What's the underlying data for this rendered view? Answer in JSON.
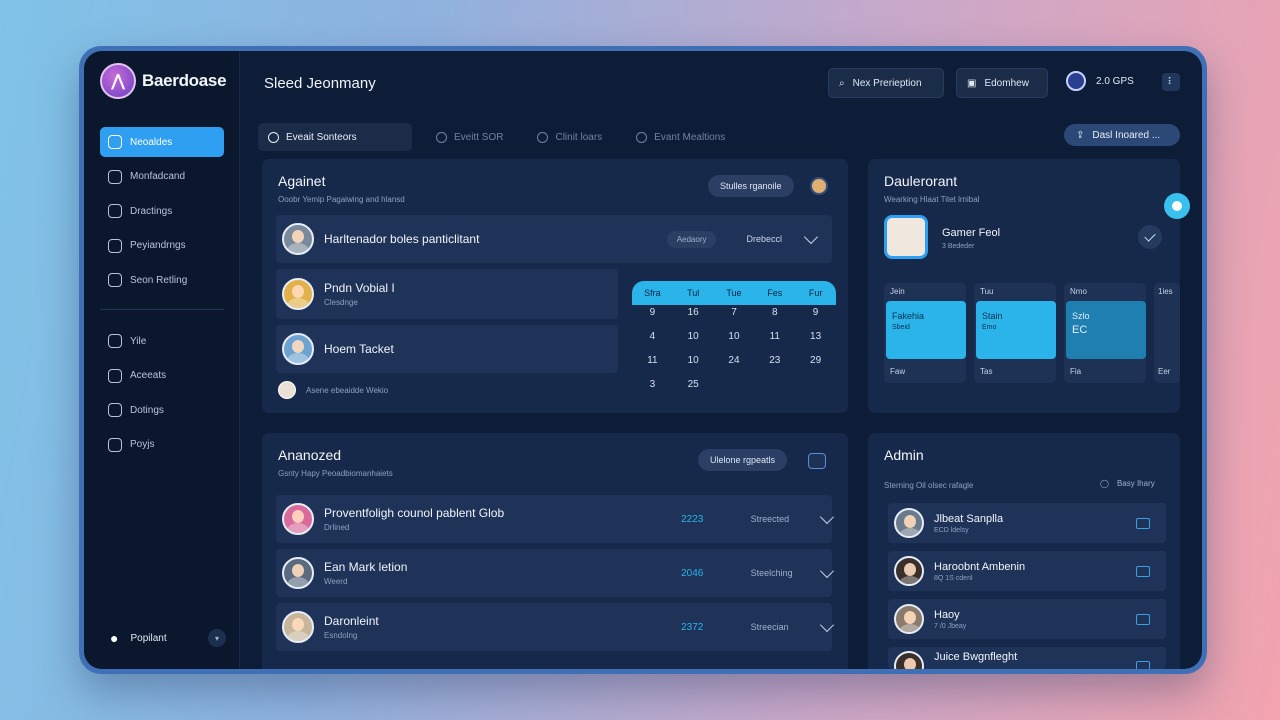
{
  "app": {
    "name": "Baerdoase",
    "page_title": "Sleed Jeonmany"
  },
  "header": {
    "search_label": "Nex Prerieption",
    "edit_label": "Edomhew",
    "status_label": "2.0 GPS",
    "menu_glyph": "⠇"
  },
  "sidebar": {
    "items": [
      {
        "label": "Neoaldes",
        "icon": "globe-icon"
      },
      {
        "label": "Monfadcand",
        "icon": "clock-icon"
      },
      {
        "label": "Dractings",
        "icon": "gear-icon"
      },
      {
        "label": "Peyiandrngs",
        "icon": "folder-icon"
      },
      {
        "label": "Seon Retling",
        "icon": "shield-icon"
      }
    ],
    "items2": [
      {
        "label": "Yile",
        "icon": "link-icon"
      },
      {
        "label": "Aceeats",
        "icon": "bell-icon"
      },
      {
        "label": "Dotings",
        "icon": "chat-icon"
      },
      {
        "label": "Poyjs",
        "icon": "doc-icon"
      }
    ],
    "footer_label": "Popilant"
  },
  "tabs": [
    {
      "label": "Eveait Sonteors"
    },
    {
      "label": "Eveitt SOR"
    },
    {
      "label": "Clinit loars"
    },
    {
      "label": "Evant Mealtions"
    }
  ],
  "tab_action": "Dasl Inoared ...",
  "agenda": {
    "title": "Againet",
    "subtitle": "Ooobr Yemip Pagaiwing and hlansd",
    "pill": "Stulles rganoile",
    "rows": [
      {
        "name": "Harltenador boles panticlitant",
        "badge": "Aedaory",
        "status": "Drebeccl"
      },
      {
        "name": "Pndn Vobial I",
        "meta": "Clesdnge"
      },
      {
        "name": "Hoem Tacket",
        "meta": ""
      }
    ],
    "footer_note": "Asene ebeaidde Wekio"
  },
  "calendar": {
    "days": [
      "Sfra",
      "Tul",
      "Tue",
      "Fes",
      "Fur"
    ],
    "dates": [
      "9",
      "16",
      "7",
      "8",
      "9",
      "4",
      "10",
      "10",
      "11",
      "13",
      "11",
      "10",
      "24",
      "23",
      "29",
      "3",
      "25",
      "",
      "",
      ""
    ]
  },
  "dashboard": {
    "title": "Daulerorant",
    "subtitle": "Wearking Hlaat Titet lrnibal",
    "profile_name": "Gamer Feol",
    "profile_sub": "3 Bededer",
    "tiles": [
      {
        "head": "Jein",
        "title": "Fakehia",
        "line2": "Sbeid",
        "foot": "Faw",
        "color": "#2bb4ea"
      },
      {
        "head": "Tuu",
        "title": "Stain",
        "line2": "Emo",
        "foot": "Tas",
        "color": "#2bb4ea"
      },
      {
        "head": "Nmo",
        "title": "Szlo",
        "line2": "EC",
        "foot": "Fia",
        "color": "#1f7fb0"
      },
      {
        "head": "1ies",
        "title": "",
        "line2": "",
        "foot": "Eer",
        "color": "#1d3255"
      }
    ]
  },
  "analyzed": {
    "title": "Ananozed",
    "subtitle": "Gsnty Hapy Peoadbiomanhaiets",
    "pill": "Ulelone rgpeatls",
    "rows": [
      {
        "name": "Proventfoligh counol pablent Glob",
        "meta": "Drlined",
        "year": "2223",
        "status": "Streected"
      },
      {
        "name": "Ean Mark letion",
        "meta": "Weerd",
        "year": "2046",
        "status": "Steelching"
      },
      {
        "name": "Daronleint",
        "meta": "Esndolng",
        "year": "2372",
        "status": "Streecian"
      }
    ]
  },
  "admin": {
    "title": "Admin",
    "subtitle": "Sterning Oil olsec rafagle",
    "filter_label": "Basy Ihary",
    "rows": [
      {
        "name": "Jlbeat Sanplla",
        "sub": "ECD ldelsy"
      },
      {
        "name": "Haroobnt Ambenin",
        "sub": "8Q 1S cdenl"
      },
      {
        "name": "Haoy",
        "sub": "7 /0 Jbeay"
      },
      {
        "name": "Juice Bwgnfleght",
        "sub": ""
      }
    ]
  },
  "colors": {
    "accent": "#2f9ff2",
    "cyan": "#2bb4ea",
    "panel": "#17294a",
    "bg": "#0e1d37"
  }
}
